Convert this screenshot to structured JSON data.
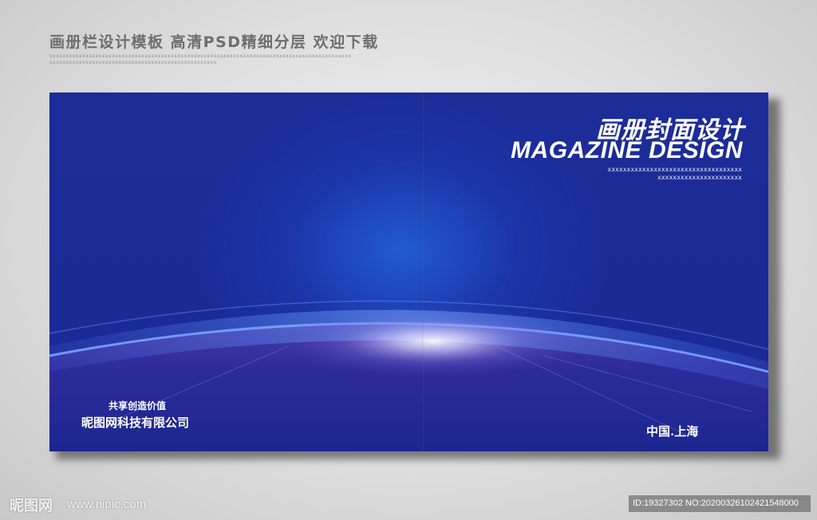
{
  "header": {
    "title": "画册栏设计模板 高清PSD精细分层 欢迎下载",
    "filler_line_1": "xxxxxxxxxxxxxxxxxxxxxxxxxxxxxxxxxxxxxxxxxxxxxxxxxxxxxxxxxxxxxxxxxxxxxxxxxxxxxxxxxxxxxxxxxxxx",
    "filler_line_2": "xxxxxxxxxxxxxxxxxxxxxxxxxxxxxxxxxxxxxxxxxxxxxxxxxxx"
  },
  "cover": {
    "title_cn": "画册封面设计",
    "title_en": "MAGAZINE DESIGN",
    "filler_line_1": "xxxxxxxxxxxxxxxxxxxxxxxxxxxxxxxxxxx",
    "filler_line_2": "xxxxxxxxxxxxxxxxxxxxxx",
    "slogan": "共享创造价值",
    "company": "昵图网科技有限公司",
    "location": "中国.上海"
  },
  "watermark": {
    "logo_text": "昵图网",
    "url": "www.nipic.com",
    "id_text": "ID:19327302 NO:20200326102421548000"
  },
  "colors": {
    "cover_background": "#1b2b96",
    "page_background": "#dedede",
    "header_text": "#6e6e6e"
  }
}
